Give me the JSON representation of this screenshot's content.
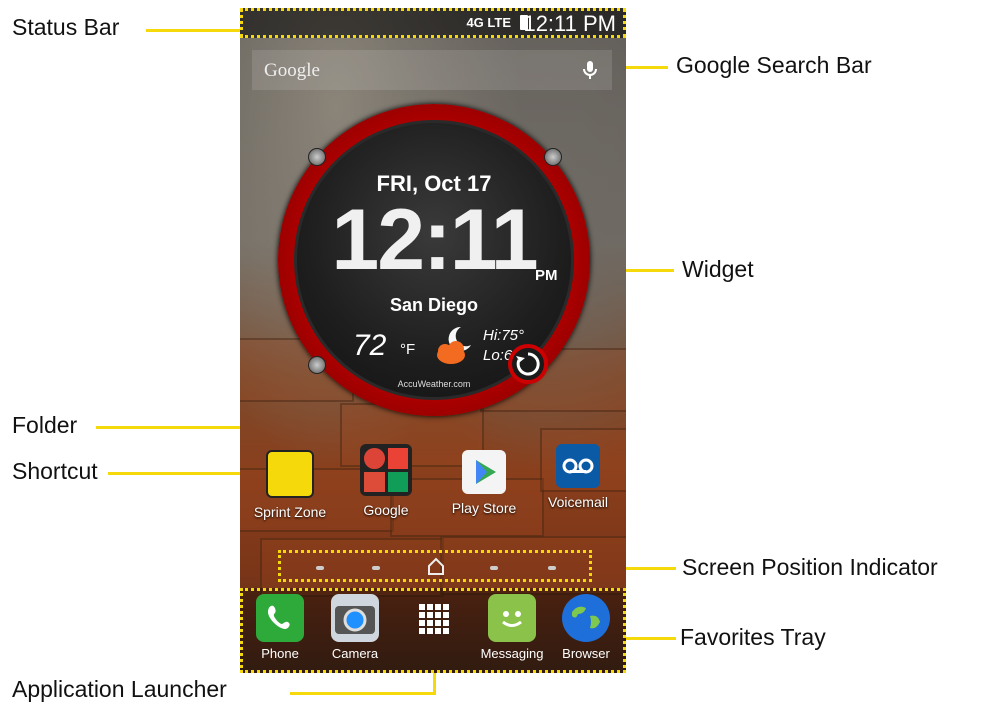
{
  "callouts": {
    "status_bar": "Status Bar",
    "google_search_bar": "Google Search Bar",
    "widget": "Widget",
    "folder": "Folder",
    "shortcut": "Shortcut",
    "screen_position_indicator": "Screen Position Indicator",
    "favorites_tray": "Favorites Tray",
    "application_launcher": "Application Launcher"
  },
  "status_bar": {
    "network": "4G LTE",
    "time": "12:11 PM"
  },
  "search_bar": {
    "label": "Google",
    "icon": "mic-icon"
  },
  "widget": {
    "date": "FRI, Oct 17",
    "time": "12:11",
    "ampm": "PM",
    "city": "San Diego",
    "temp": "72",
    "unit": "°F",
    "hi": "Hi:75°",
    "lo": "Lo:66°",
    "brand": "AccuWeather.com",
    "weather_icon": "partly-cloudy-night-icon"
  },
  "apps": [
    {
      "label": "Sprint Zone",
      "icon": "sprint-zone-icon"
    },
    {
      "label": "Google",
      "icon": "google-folder-icon"
    },
    {
      "label": "Play Store",
      "icon": "play-store-icon"
    },
    {
      "label": "Voicemail",
      "icon": "voicemail-icon"
    }
  ],
  "favorites": [
    {
      "label": "Phone",
      "icon": "phone-icon"
    },
    {
      "label": "Camera",
      "icon": "camera-icon"
    },
    {
      "label": "",
      "icon": "app-launcher-icon"
    },
    {
      "label": "Messaging",
      "icon": "messaging-icon"
    },
    {
      "label": "Browser",
      "icon": "browser-icon"
    }
  ],
  "colors": {
    "callout_line": "#f5d90a",
    "widget_ring": "#c00000"
  }
}
